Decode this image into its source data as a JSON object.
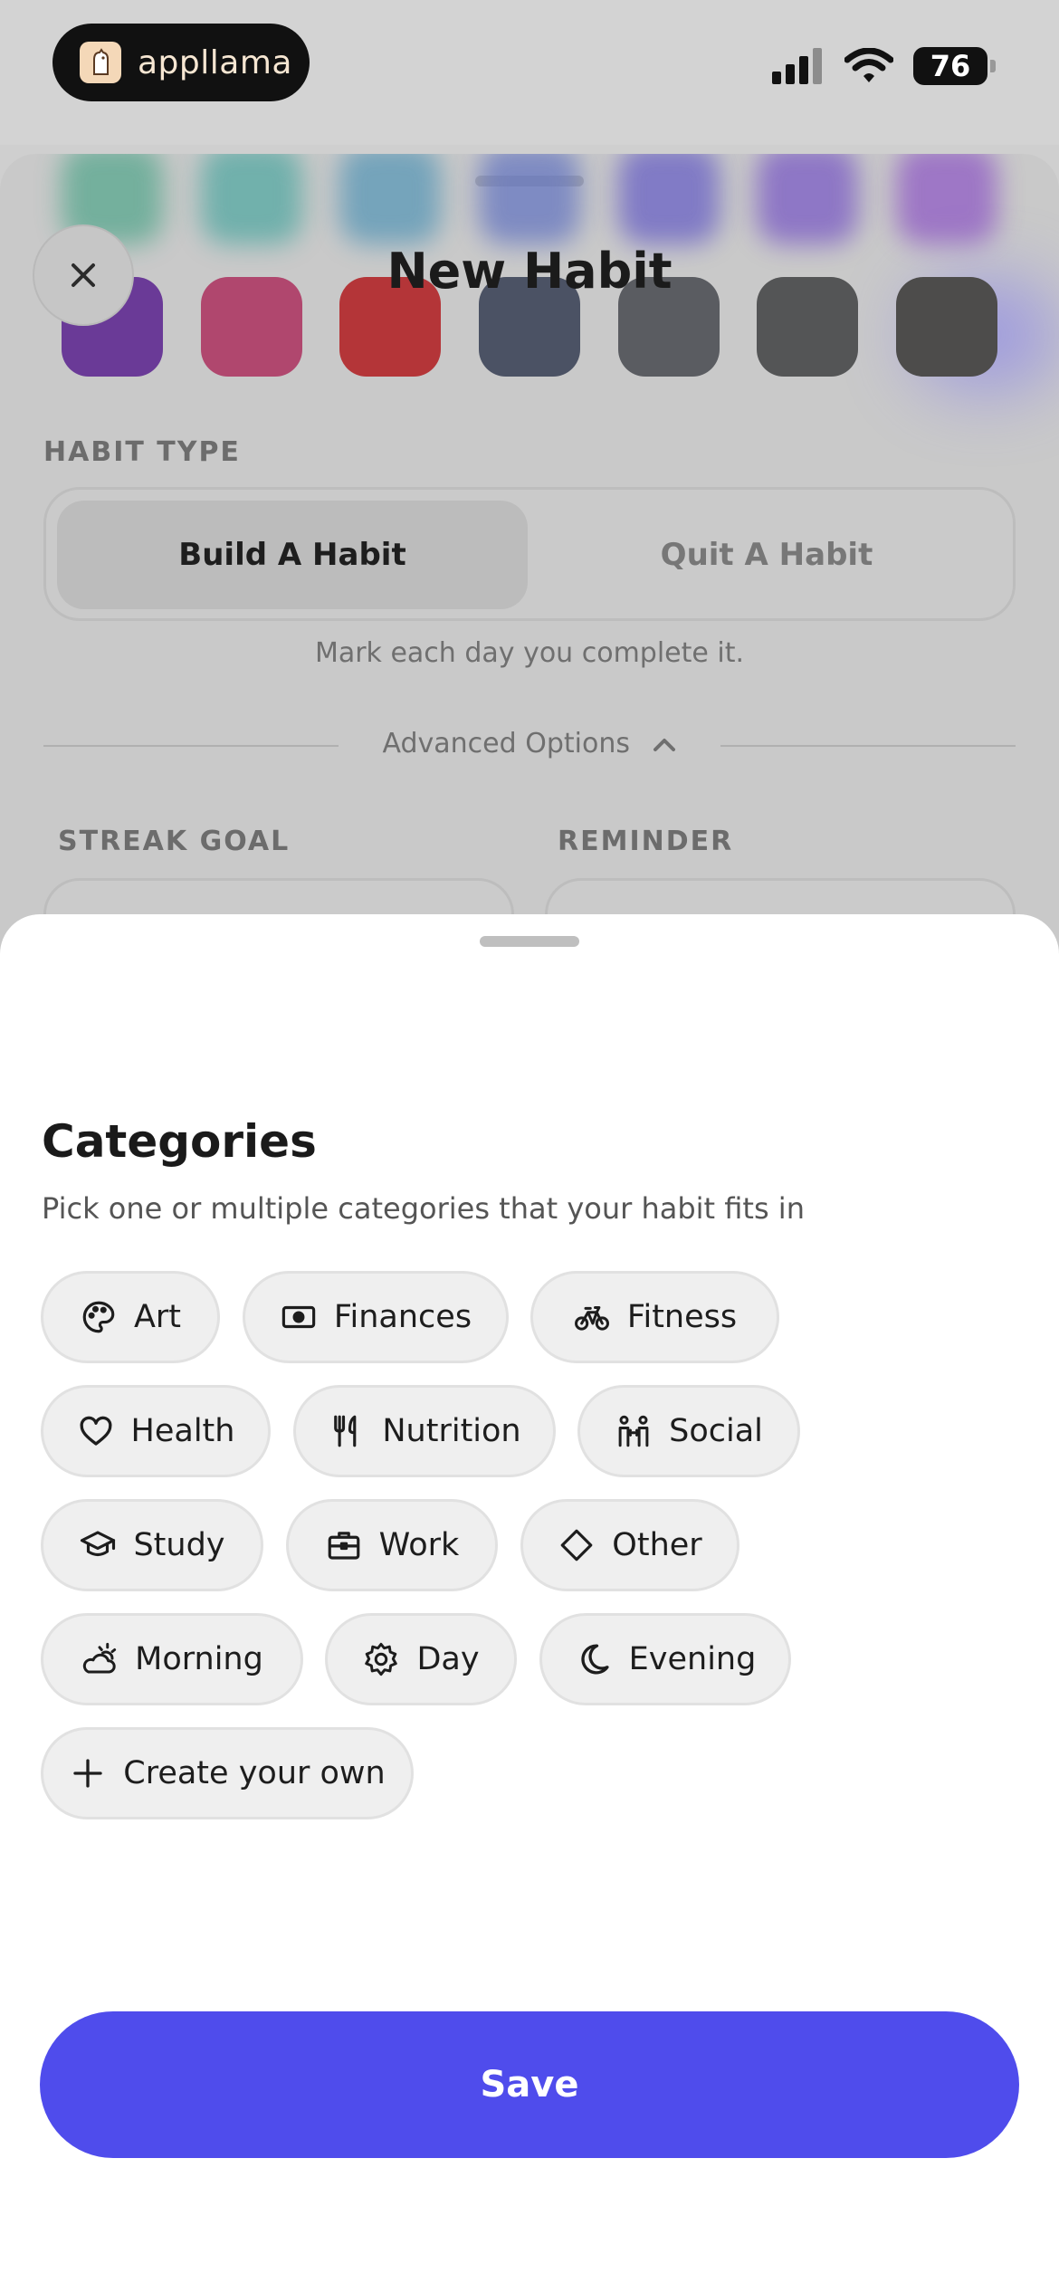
{
  "status_bar": {
    "brand_name": "appllama",
    "battery_level": "76"
  },
  "background": {
    "title": "New Habit",
    "habit_type_label": "HABIT TYPE",
    "build_label": "Build A Habit",
    "quit_label": "Quit A Habit",
    "hint": "Mark each day you complete it.",
    "advanced_options": "Advanced Options",
    "streak_goal_label": "STREAK GOAL",
    "reminder_label": "REMINDER",
    "swatch_colors": [
      "#6a3a97",
      "#b0476e",
      "#b43538",
      "#4b5264",
      "#5a5c61",
      "#545556",
      "#4d4c4b"
    ],
    "swatch_colors_top": [
      "#57a78e",
      "#53a8a2",
      "#5897b6",
      "#6576c0",
      "#6860c4",
      "#7a5bc4",
      "#8f5bc4"
    ]
  },
  "sheet": {
    "title": "Categories",
    "subtitle": "Pick one or multiple categories that your habit fits in",
    "categories": [
      {
        "label": "Art",
        "icon": "palette-icon"
      },
      {
        "label": "Finances",
        "icon": "banknote-icon"
      },
      {
        "label": "Fitness",
        "icon": "bicycle-icon"
      },
      {
        "label": "Health",
        "icon": "heart-icon"
      },
      {
        "label": "Nutrition",
        "icon": "utensils-icon"
      },
      {
        "label": "Social",
        "icon": "people-icon"
      },
      {
        "label": "Study",
        "icon": "graduation-cap-icon"
      },
      {
        "label": "Work",
        "icon": "briefcase-icon"
      },
      {
        "label": "Other",
        "icon": "diamond-icon"
      },
      {
        "label": "Morning",
        "icon": "sunrise-cloud-icon"
      },
      {
        "label": "Day",
        "icon": "sun-gear-icon"
      },
      {
        "label": "Evening",
        "icon": "moon-icon"
      }
    ],
    "create_own": "Create your own",
    "save_label": "Save"
  },
  "colors": {
    "accent": "#4f4cec",
    "chip_bg": "#efefef"
  }
}
